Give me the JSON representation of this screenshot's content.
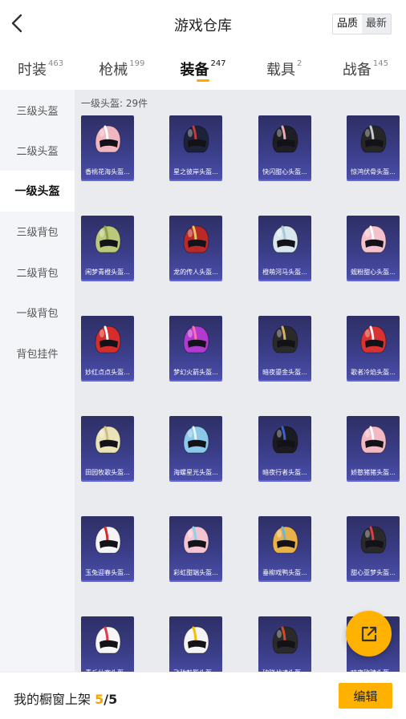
{
  "header": {
    "title": "游戏仓库",
    "sort_options": [
      "品质",
      "最新"
    ],
    "sort_selected": "品质"
  },
  "tabs": [
    {
      "label": "时装",
      "count": "463",
      "active": false
    },
    {
      "label": "枪械",
      "count": "199",
      "active": false
    },
    {
      "label": "装备",
      "count": "247",
      "active": true
    },
    {
      "label": "载具",
      "count": "2",
      "active": false
    },
    {
      "label": "战备",
      "count": "145",
      "active": false
    }
  ],
  "sidebar": {
    "items": [
      "三级头盔",
      "二级头盔",
      "一级头盔",
      "三级背包",
      "二级背包",
      "一级背包",
      "背包挂件"
    ],
    "active": "一级头盔"
  },
  "section": {
    "title": "一级头盔: 29件"
  },
  "items": [
    {
      "name": "香桃花海头盔...",
      "color": "#f2b6c0",
      "accent": "#ffffff"
    },
    {
      "name": "星之彼岸头盔...",
      "color": "#1c2238",
      "accent": "#c63a3a"
    },
    {
      "name": "快闪甜心头盔...",
      "color": "#1e1e24",
      "accent": "#f2a7b8"
    },
    {
      "name": "惊鸿伏骨头盔...",
      "color": "#262626",
      "accent": "#c9c9c9"
    },
    {
      "name": "闲梦青橙头盔...",
      "color": "#b9c87a",
      "accent": "#8aa04a"
    },
    {
      "name": "龙的传人头盔...",
      "color": "#b82a2a",
      "accent": "#e8c45a"
    },
    {
      "name": "橙萌河马头盔...",
      "color": "#d8e6ee",
      "accent": "#a9c7d6"
    },
    {
      "name": "蚬粉甜心头盔...",
      "color": "#f4c2cc",
      "accent": "#ffffff"
    },
    {
      "name": "妙红点点头盔...",
      "color": "#d62c2c",
      "accent": "#ffffff"
    },
    {
      "name": "梦幻火箭头盔...",
      "color": "#b23ad0",
      "accent": "#ff6fb0"
    },
    {
      "name": "暗夜鎏金头盔...",
      "color": "#2a2a2a",
      "accent": "#d8b25a"
    },
    {
      "name": "歌者冷焰头盔...",
      "color": "#d83232",
      "accent": "#f2f2f2"
    },
    {
      "name": "田园牧歌头盔...",
      "color": "#ebe3b8",
      "accent": "#cdbf84"
    },
    {
      "name": "海螺星光头盔...",
      "color": "#8cc8ea",
      "accent": "#e6f4fb"
    },
    {
      "name": "暗夜行者头盔...",
      "color": "#1b1b22",
      "accent": "#3c5ed8"
    },
    {
      "name": "娇憨猪猪头盔...",
      "color": "#f2b8c4",
      "accent": "#ffffff"
    },
    {
      "name": "玉兔迎春头盔...",
      "color": "#f4f4f4",
      "accent": "#d62c2c"
    },
    {
      "name": "彩虹甜端头盔...",
      "color": "#f4c4d2",
      "accent": "#8cd2ea"
    },
    {
      "name": "垂柳戏鸭头盔...",
      "color": "#e9b14a",
      "accent": "#6ab6e2"
    },
    {
      "name": "甜心亚梦头盔...",
      "color": "#2a2a2a",
      "accent": "#e23a4a"
    },
    {
      "name": "青丘仙客头盔...",
      "color": "#f6f6f6",
      "accent": "#e23a4a"
    },
    {
      "name": "飞驰魅影头盔...",
      "color": "#f4f4f4",
      "accent": "#f2c200"
    },
    {
      "name": "破晓战魂头盔...",
      "color": "#2a2a2a",
      "accent": "#d24a2a"
    },
    {
      "name": "暗夜玫瑰头盔...",
      "color": "#d83232",
      "accent": "#ffffff"
    }
  ],
  "footer": {
    "label": "我的橱窗上架",
    "current": "5",
    "separator": "/",
    "total": "5",
    "edit_label": "编辑"
  },
  "colors": {
    "accent": "#ffb100",
    "card_top": "#2e2f66",
    "card_bottom": "#4a4eaa"
  }
}
